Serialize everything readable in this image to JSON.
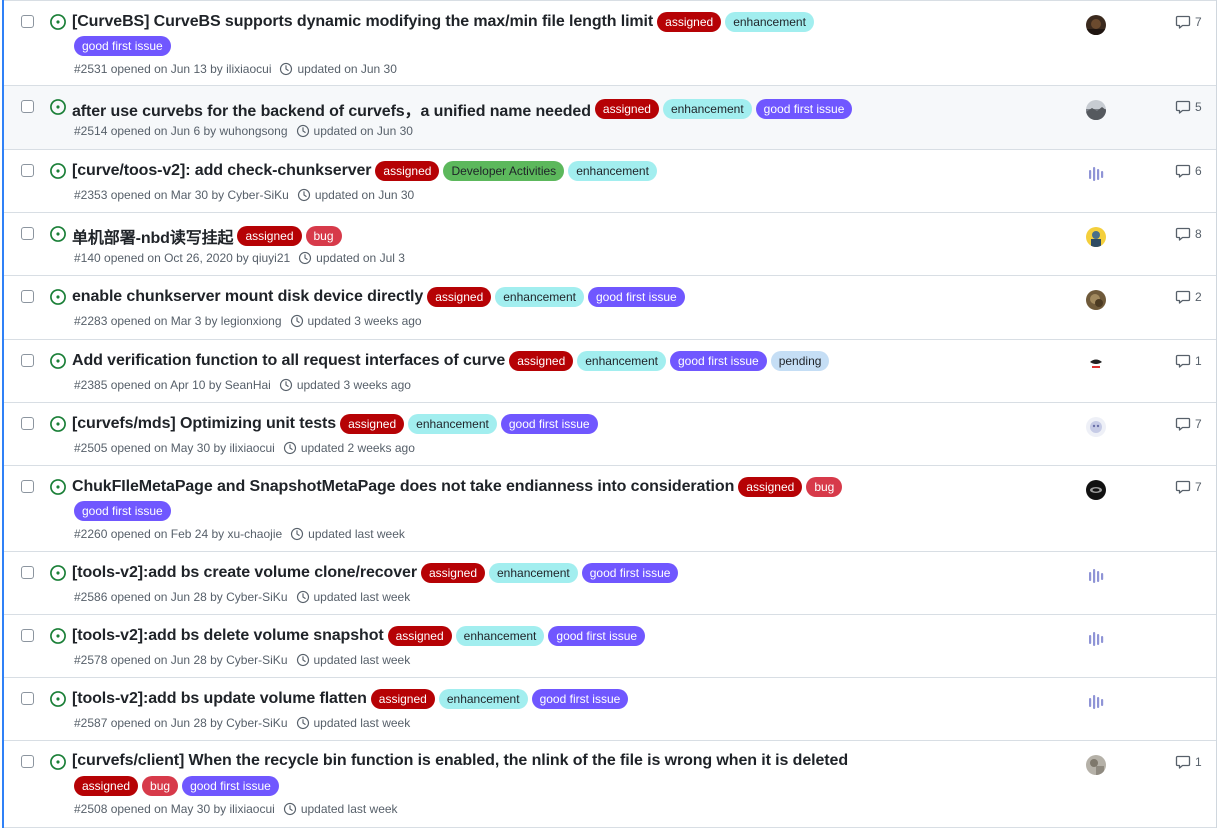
{
  "label_styles": {
    "assigned": {
      "bg": "#b60205",
      "fg": "#ffffff"
    },
    "enhancement": {
      "bg": "#a2eeef",
      "fg": "#1f2328"
    },
    "good first issue": {
      "bg": "#7057ff",
      "fg": "#ffffff"
    },
    "Developer Activities": {
      "bg": "#5cb85c",
      "fg": "#1f2328"
    },
    "bug": {
      "bg": "#d73a4a",
      "fg": "#ffffff"
    },
    "pending": {
      "bg": "#c5def5",
      "fg": "#1f2328"
    }
  },
  "issues": [
    {
      "title": "[CurveBS] CurveBS supports dynamic modifying the max/min file length limit",
      "labels_inline": [
        "assigned",
        "enhancement"
      ],
      "labels_wrap": [
        "good first issue"
      ],
      "meta": "#2531 opened on Jun 13 by ilixiaocui",
      "updated": "updated on Jun 30",
      "comments": "7",
      "avatar": "dark"
    },
    {
      "title": "after use curvebs for the backend of curvefs，a unified name needed",
      "labels_inline": [
        "assigned",
        "enhancement",
        "good first issue"
      ],
      "labels_wrap": [],
      "meta": "#2514 opened on Jun 6 by wuhongsong",
      "updated": "updated on Jun 30",
      "comments": "5",
      "avatar": "landscape"
    },
    {
      "title": "[curve/toos-v2]: add check-chunkserver",
      "labels_inline": [
        "assigned",
        "Developer Activities",
        "enhancement"
      ],
      "labels_wrap": [],
      "meta": "#2353 opened on Mar 30 by Cyber-SiKu",
      "updated": "updated on Jun 30",
      "comments": "6",
      "avatar": "bars"
    },
    {
      "title": "单机部署-nbd读写挂起",
      "labels_inline": [
        "assigned",
        "bug"
      ],
      "labels_wrap": [],
      "meta": "#140 opened on Oct 26, 2020 by qiuyi21",
      "updated": "updated on Jul 3",
      "comments": "8",
      "avatar": "yellow"
    },
    {
      "title": "enable chunkserver mount disk device directly",
      "labels_inline": [
        "assigned",
        "enhancement",
        "good first issue"
      ],
      "labels_wrap": [],
      "meta": "#2283 opened on Mar 3 by legionxiong",
      "updated": "updated 3 weeks ago",
      "comments": "2",
      "avatar": "brown"
    },
    {
      "title": "Add verification function to all request interfaces of curve",
      "labels_inline": [
        "assigned",
        "enhancement",
        "good first issue",
        "pending"
      ],
      "labels_wrap": [],
      "meta": "#2385 opened on Apr 10 by SeanHai",
      "updated": "updated 3 weeks ago",
      "comments": "1",
      "avatar": "logo"
    },
    {
      "title": "[curvefs/mds] Optimizing unit tests",
      "labels_inline": [
        "assigned",
        "enhancement",
        "good first issue"
      ],
      "labels_wrap": [],
      "meta": "#2505 opened on May 30 by ilixiaocui",
      "updated": "updated 2 weeks ago",
      "comments": "7",
      "avatar": "pale"
    },
    {
      "title": "ChukFIleMetaPage and SnapshotMetaPage does not take endianness into consideration",
      "labels_inline": [
        "assigned",
        "bug"
      ],
      "labels_wrap": [
        "good first issue"
      ],
      "meta": "#2260 opened on Feb 24 by xu-chaojie",
      "updated": "updated last week",
      "comments": "7",
      "avatar": "black"
    },
    {
      "title": "[tools-v2]:add bs create volume clone/recover",
      "labels_inline": [
        "assigned",
        "enhancement",
        "good first issue"
      ],
      "labels_wrap": [],
      "meta": "#2586 opened on Jun 28 by Cyber-SiKu",
      "updated": "updated last week",
      "comments": "",
      "avatar": "bars"
    },
    {
      "title": "[tools-v2]:add bs delete volume snapshot",
      "labels_inline": [
        "assigned",
        "enhancement",
        "good first issue"
      ],
      "labels_wrap": [],
      "meta": "#2578 opened on Jun 28 by Cyber-SiKu",
      "updated": "updated last week",
      "comments": "",
      "avatar": "bars"
    },
    {
      "title": "[tools-v2]:add bs update volume flatten",
      "labels_inline": [
        "assigned",
        "enhancement",
        "good first issue"
      ],
      "labels_wrap": [],
      "meta": "#2587 opened on Jun 28 by Cyber-SiKu",
      "updated": "updated last week",
      "comments": "",
      "avatar": "bars"
    },
    {
      "title": "[curvefs/client] When the recycle bin function is enabled, the nlink of the file is wrong when it is deleted",
      "labels_inline": [],
      "labels_wrap": [
        "assigned",
        "bug",
        "good first issue"
      ],
      "meta": "#2508 opened on May 30 by ilixiaocui",
      "updated": "updated last week",
      "comments": "1",
      "avatar": "grey"
    }
  ]
}
